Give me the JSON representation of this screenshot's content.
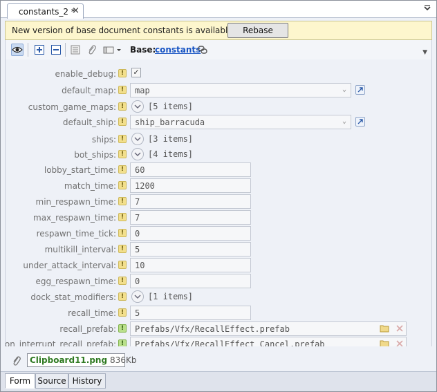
{
  "tab": {
    "title": "constants_2 *",
    "close": "×"
  },
  "notification": {
    "message": "New version of base document constants is available.",
    "button": "Rebase"
  },
  "toolbar": {
    "base_label": "Base:",
    "base_link": "constants"
  },
  "fields": [
    {
      "label": "enable_debug:",
      "kind": "checkbox",
      "value": "✓",
      "marker": "!"
    },
    {
      "label": "default_map:",
      "kind": "combo",
      "value": "map",
      "marker": "!"
    },
    {
      "label": "custom_game_maps:",
      "kind": "list",
      "value": "[5 items]",
      "marker": "!"
    },
    {
      "label": "default_ship:",
      "kind": "combo",
      "value": "ship_barracuda",
      "marker": "!"
    },
    {
      "label": "ships:",
      "kind": "list",
      "value": "[3 items]",
      "marker": "!"
    },
    {
      "label": "bot_ships:",
      "kind": "list",
      "value": "[4 items]",
      "marker": "!"
    },
    {
      "label": "lobby_start_time:",
      "kind": "number",
      "value": "60",
      "marker": "!"
    },
    {
      "label": "match_time:",
      "kind": "number",
      "value": "1200",
      "marker": "!"
    },
    {
      "label": "min_respawn_time:",
      "kind": "number",
      "value": "7",
      "marker": "!"
    },
    {
      "label": "max_respawn_time:",
      "kind": "number",
      "value": "7",
      "marker": "!"
    },
    {
      "label": "respawn_time_tick:",
      "kind": "number",
      "value": "0",
      "marker": "!"
    },
    {
      "label": "multikill_interval:",
      "kind": "number",
      "value": "5",
      "marker": "!"
    },
    {
      "label": "under_attack_interval:",
      "kind": "number",
      "value": "10",
      "marker": "!"
    },
    {
      "label": "egg_respawn_time:",
      "kind": "number",
      "value": "0",
      "marker": "!"
    },
    {
      "label": "dock_stat_modifiers:",
      "kind": "list",
      "value": "[1 items]",
      "marker": "!"
    },
    {
      "label": "recall_time:",
      "kind": "number",
      "value": "5",
      "marker": "!"
    },
    {
      "label": "recall_prefab:",
      "kind": "path",
      "value": "Prefabs/Vfx/RecallEffect.prefab",
      "marker": "!"
    },
    {
      "label": "on_interrupt_recall_prefab:",
      "kind": "path",
      "value": "Prefabs/Vfx/RecallEffect_Cancel.prefab",
      "marker": "!"
    }
  ],
  "attachment": {
    "name": "Clipboard11.png",
    "size": "836Kb"
  },
  "bottom_tabs": [
    "Form",
    "Source",
    "History"
  ],
  "colors": {
    "link": "#1a56c4",
    "notify_bg": "#fdf6cd",
    "attachment_name": "#2f7a22"
  }
}
